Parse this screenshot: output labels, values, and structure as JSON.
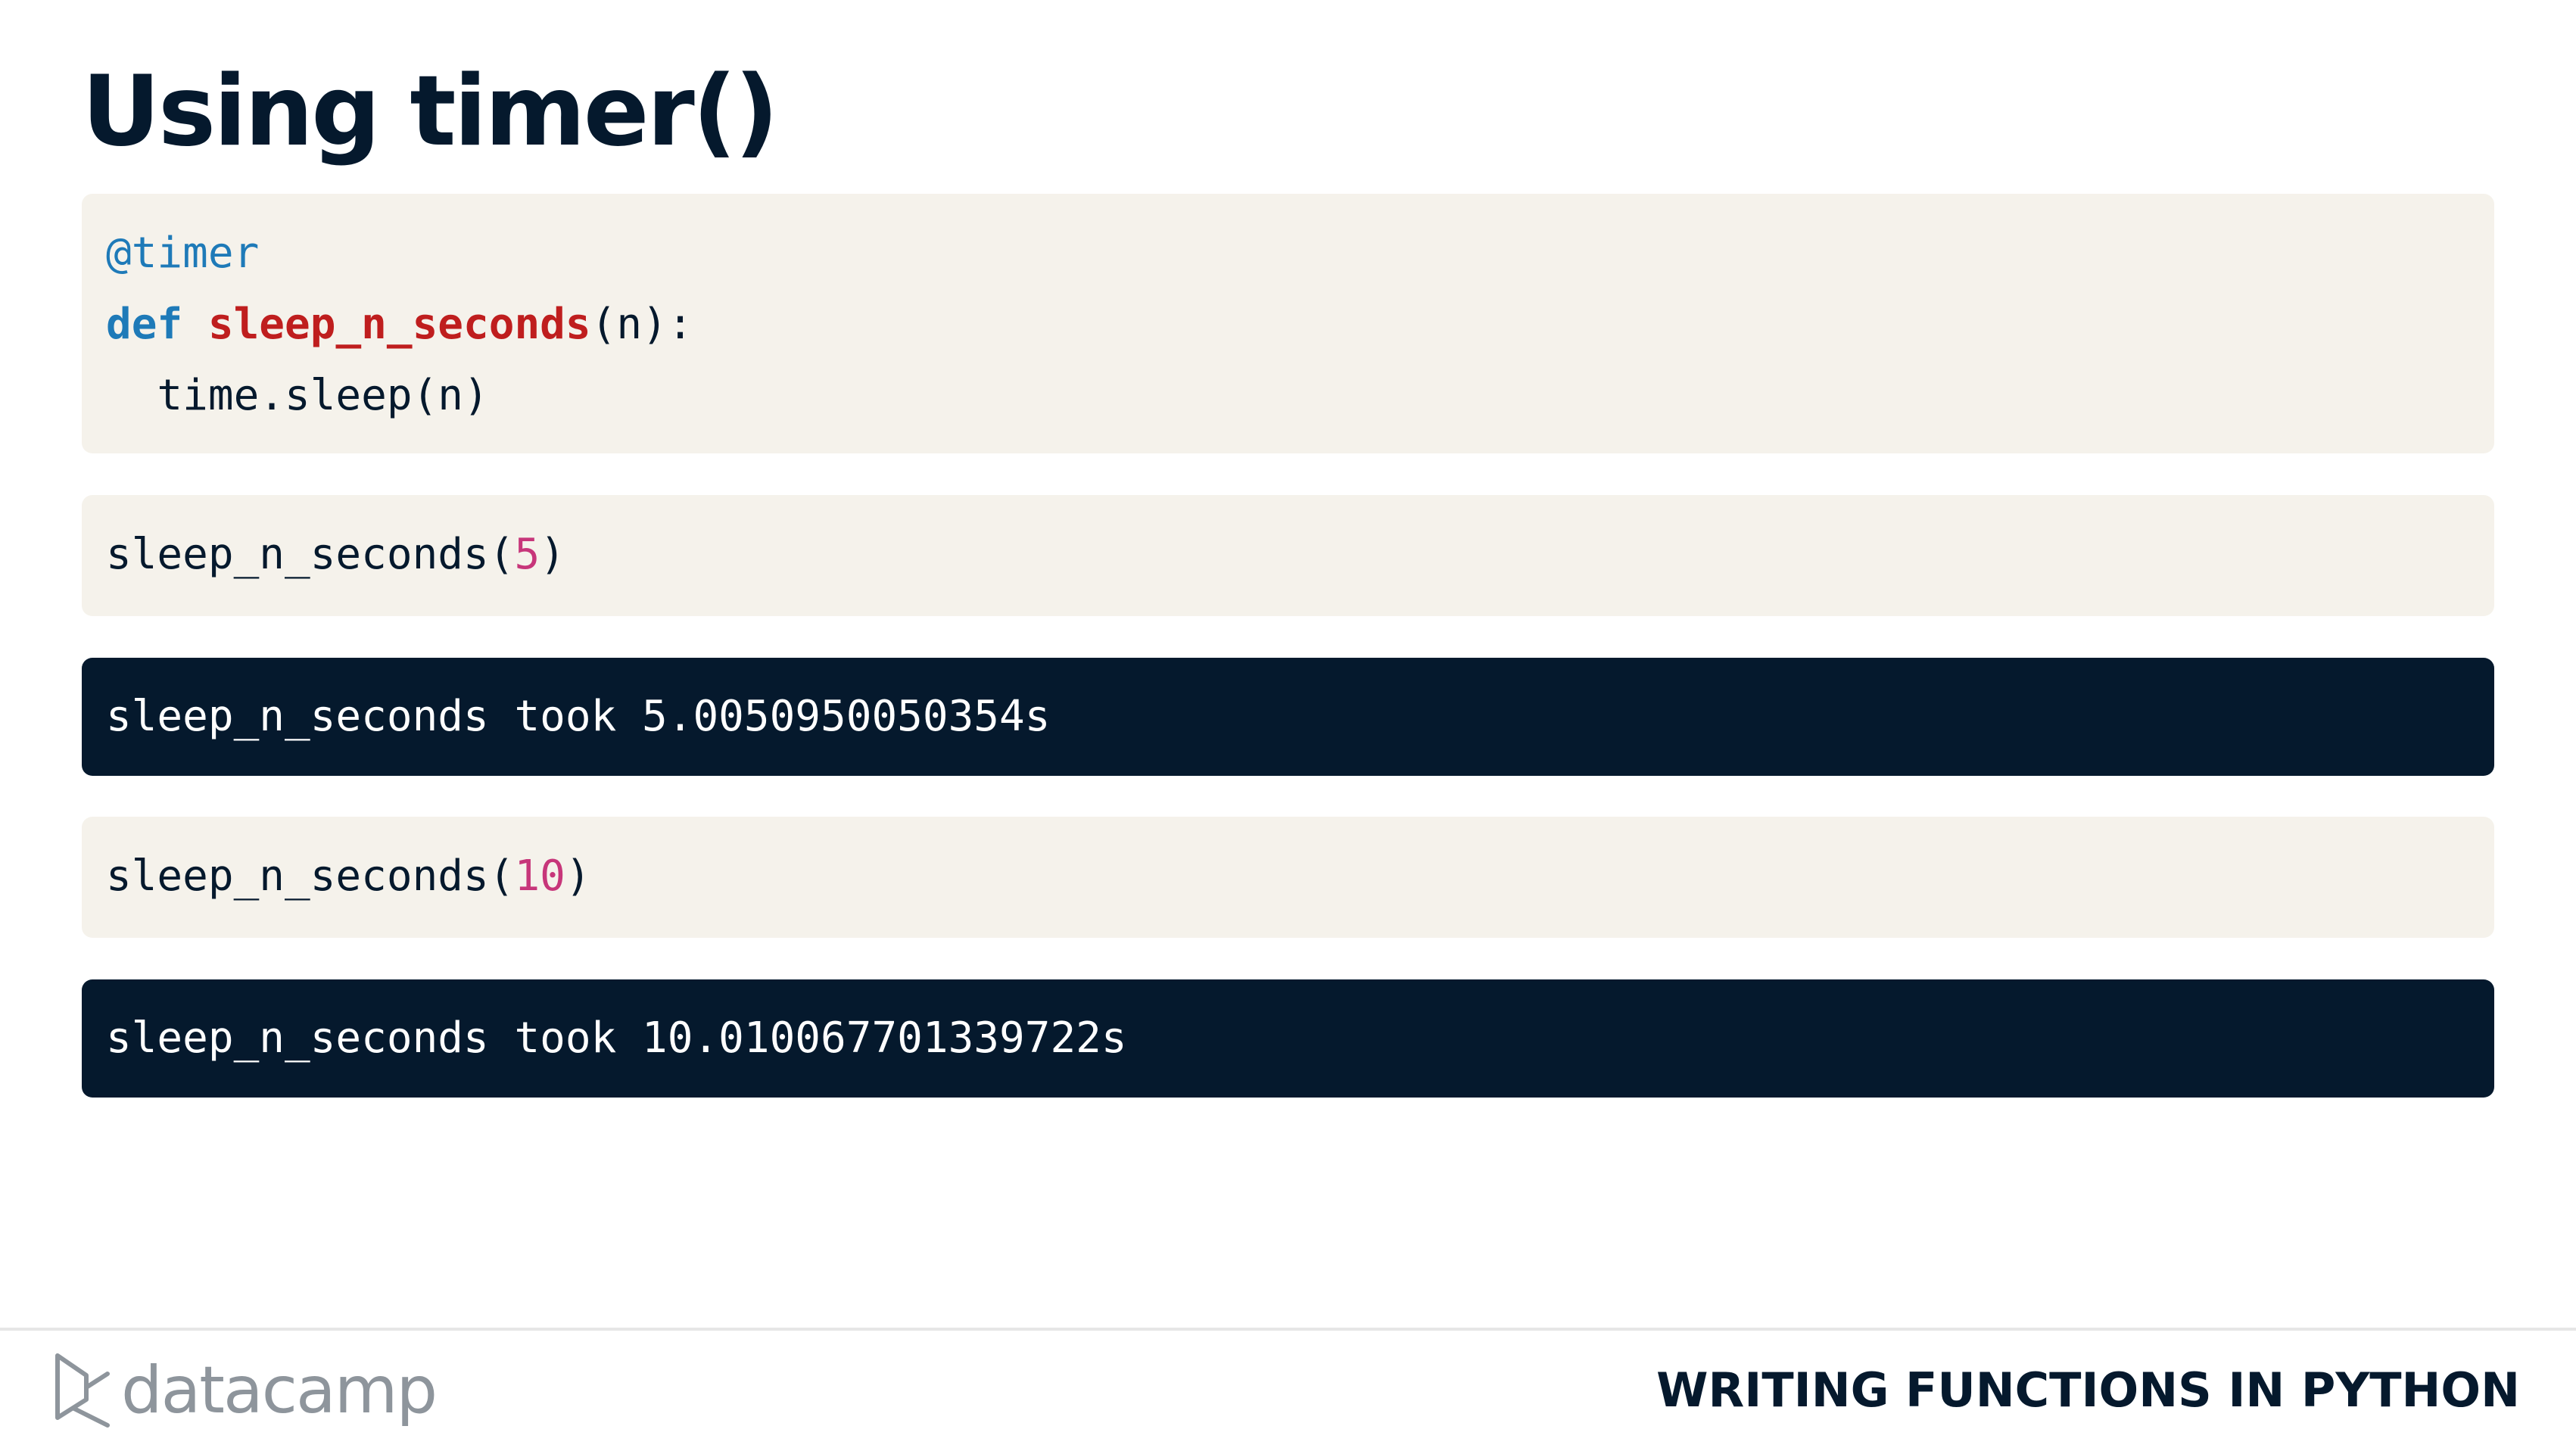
{
  "slide": {
    "title": "Using timer()"
  },
  "code_cells": [
    {
      "kind": "input",
      "lines": [
        [
          {
            "text": "@timer",
            "style": "decorator"
          }
        ],
        [
          {
            "text": "def",
            "style": "keyword"
          },
          {
            "text": " ",
            "style": "plain"
          },
          {
            "text": "sleep_n_seconds",
            "style": "funcname"
          },
          {
            "text": "(n):",
            "style": "plain"
          }
        ],
        [
          {
            "text": "  time.sleep(n)",
            "style": "plain"
          }
        ]
      ]
    },
    {
      "kind": "input",
      "lines": [
        [
          {
            "text": "sleep_n_seconds(",
            "style": "plain"
          },
          {
            "text": "5",
            "style": "number"
          },
          {
            "text": ")",
            "style": "plain"
          }
        ]
      ]
    },
    {
      "kind": "output",
      "lines": [
        [
          {
            "text": "sleep_n_seconds took 5.0050950050354s",
            "style": "output"
          }
        ]
      ]
    },
    {
      "kind": "input",
      "lines": [
        [
          {
            "text": "sleep_n_seconds(",
            "style": "plain"
          },
          {
            "text": "10",
            "style": "number"
          },
          {
            "text": ")",
            "style": "plain"
          }
        ]
      ]
    },
    {
      "kind": "output",
      "lines": [
        [
          {
            "text": "sleep_n_seconds took 10.010067701339722s",
            "style": "output"
          }
        ]
      ]
    }
  ],
  "footer": {
    "logo_text": "datacamp",
    "logo_icon": "datacamp-logo-icon",
    "course_title": "WRITING FUNCTIONS IN PYTHON"
  },
  "colors": {
    "code_background": "#f5f2eb",
    "output_background": "#05192d",
    "decorator_keyword": "#1e7ab8",
    "function_name": "#bf1e1e",
    "number_literal": "#c7367a",
    "text_dark": "#05192d",
    "logo_gray": "#8e959c"
  }
}
